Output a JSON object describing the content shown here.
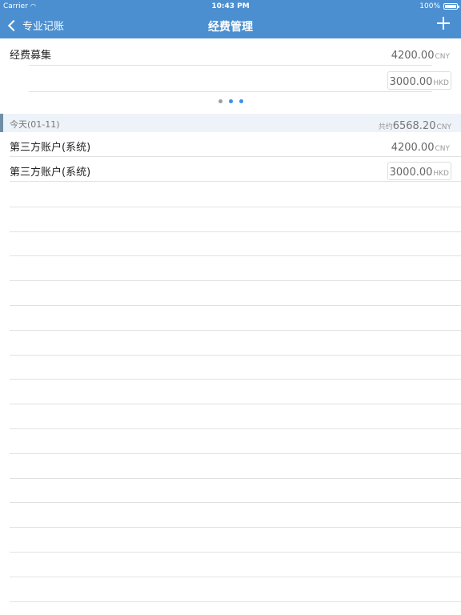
{
  "status_bar": {
    "carrier": "Carrier",
    "time": "10:43 PM",
    "battery": "100%"
  },
  "nav": {
    "back_label": "专业记账",
    "title": "经费管理"
  },
  "fund": {
    "name": "经费募集",
    "amounts": [
      {
        "value": "4200.00",
        "currency": "CNY"
      },
      {
        "value": "3000.00",
        "currency": "HKD"
      }
    ],
    "pager": {
      "pages": 3,
      "active": 1
    }
  },
  "day_group": {
    "label": "今天(01-11)",
    "total_prefix": "共约",
    "total_value": "6568.20",
    "total_currency": "CNY"
  },
  "transactions": [
    {
      "name": "第三方账户(系统)",
      "value": "4200.00",
      "currency": "CNY"
    },
    {
      "name": "第三方账户(系统)",
      "value": "3000.00",
      "currency": "HKD"
    }
  ],
  "colors": {
    "nav_bg": "#4b8fd1",
    "dot_active": "#3b8ff0",
    "dot_inactive": "#9e9e9e",
    "day_bg": "#eef3f9"
  }
}
